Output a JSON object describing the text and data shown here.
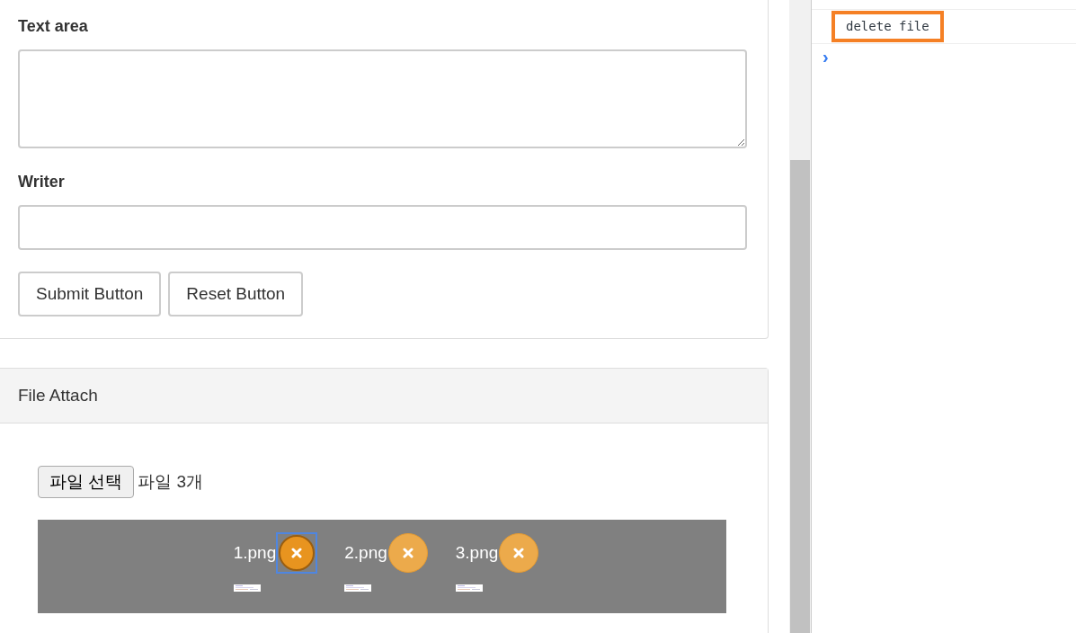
{
  "form": {
    "textarea": {
      "label": "Text area"
    },
    "writer": {
      "label": "Writer"
    },
    "buttons": [
      "Submit Button",
      "Reset Button"
    ]
  },
  "file_attach": {
    "title": "File Attach",
    "choose_button": "파일 선택",
    "file_count": "파일 3개",
    "files": [
      {
        "name": "1.png",
        "selected": true
      },
      {
        "name": "2.png",
        "selected": false
      },
      {
        "name": "3.png",
        "selected": false
      }
    ]
  },
  "console": {
    "messages": [
      "delete file"
    ],
    "prompt": "›"
  }
}
